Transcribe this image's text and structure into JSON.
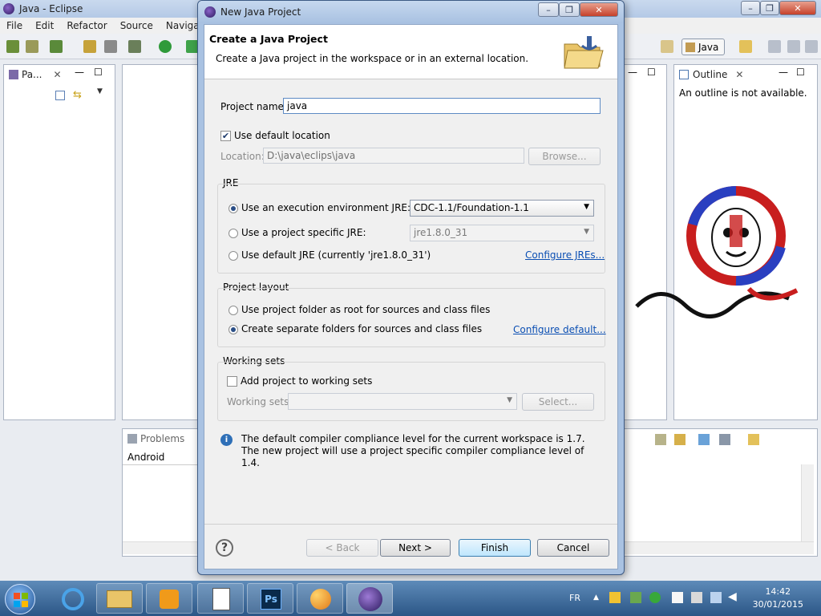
{
  "eclipse": {
    "window_title": "Java - Eclipse",
    "menu": [
      "File",
      "Edit",
      "Refactor",
      "Source",
      "Navigate"
    ],
    "perspective_label": "Java",
    "package_explorer_tab": "Pa...",
    "outline_tab": "Outline",
    "outline_message": "An outline is not available.",
    "problems_tab": "Problems",
    "problems_row": "Android"
  },
  "dialog": {
    "title": "New Java Project",
    "header_title": "Create a Java Project",
    "header_description": "Create a Java project in the workspace or in an external location.",
    "project_name_label": "Project name:",
    "project_name_value": "java",
    "use_default_location_label": "Use default location",
    "location_label": "Location:",
    "location_value": "D:\\java\\eclips\\java",
    "browse_label": "Browse...",
    "jre": {
      "group_label": "JRE",
      "exec_env_label": "Use an execution environment JRE:",
      "exec_env_value": "CDC-1.1/Foundation-1.1",
      "project_specific_label": "Use a project specific JRE:",
      "project_specific_value": "jre1.8.0_31",
      "default_jre_label": "Use default JRE (currently 'jre1.8.0_31')",
      "configure_link": "Configure JREs..."
    },
    "layout": {
      "group_label": "Project layout",
      "root_option": "Use project folder as root for sources and class files",
      "separate_option": "Create separate folders for sources and class files",
      "configure_link": "Configure default..."
    },
    "working_sets": {
      "group_label": "Working sets",
      "add_label": "Add project to working sets",
      "sets_label": "Working sets:",
      "select_label": "Select..."
    },
    "info_message": "The default compiler compliance level for the current workspace is 1.7. The new project will use a project specific compiler compliance level of 1.4.",
    "buttons": {
      "back": "< Back",
      "next": "Next >",
      "finish": "Finish",
      "cancel": "Cancel"
    }
  },
  "taskbar": {
    "language": "FR",
    "time": "14:42",
    "date": "30/01/2015"
  }
}
